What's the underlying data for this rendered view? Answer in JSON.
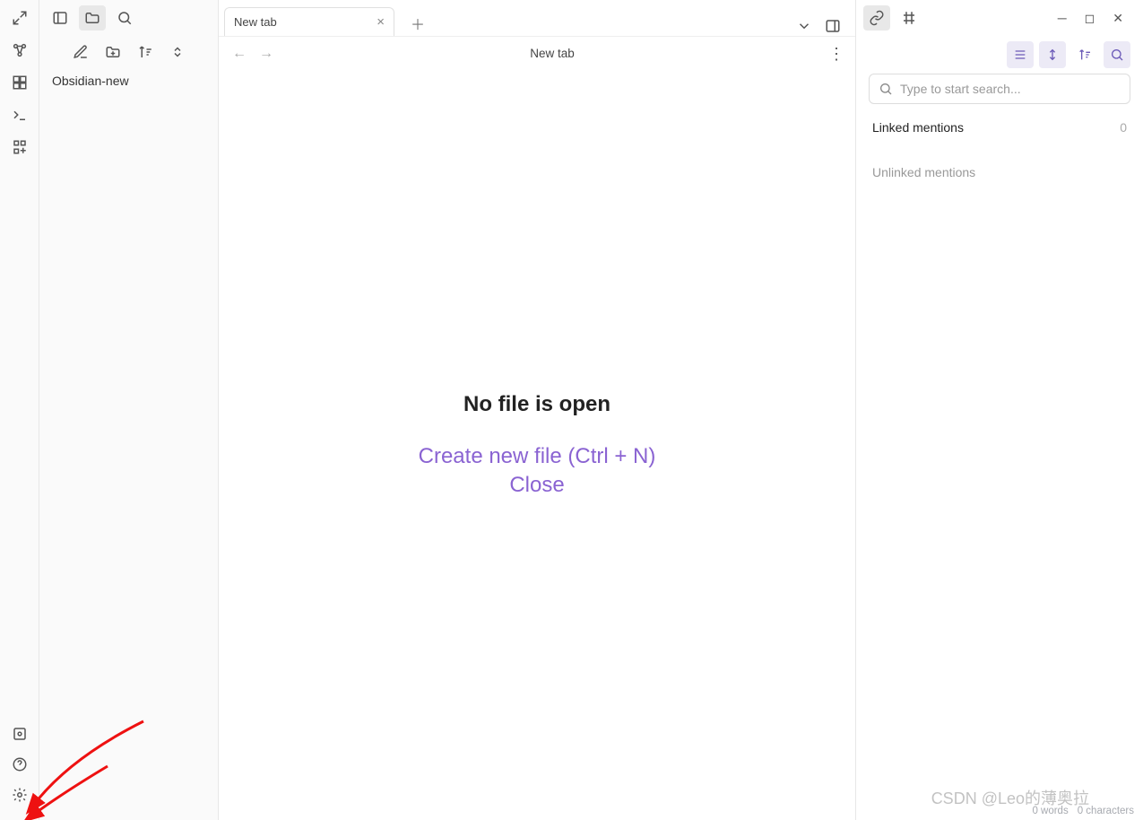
{
  "sidebar": {
    "vault_name": "Obsidian-new"
  },
  "tabs": {
    "items": [
      {
        "label": "New tab"
      }
    ]
  },
  "content": {
    "title": "New tab",
    "nofile_msg": "No file is open",
    "create_label": "Create new file (Ctrl + N)",
    "close_label": "Close"
  },
  "right": {
    "search_placeholder": "Type to start search...",
    "linked_label": "Linked mentions",
    "linked_count": "0",
    "unlinked_label": "Unlinked mentions"
  },
  "status": {
    "words": "0 words",
    "chars": "0 characters"
  },
  "watermark": "CSDN @Leo的薄奥拉"
}
